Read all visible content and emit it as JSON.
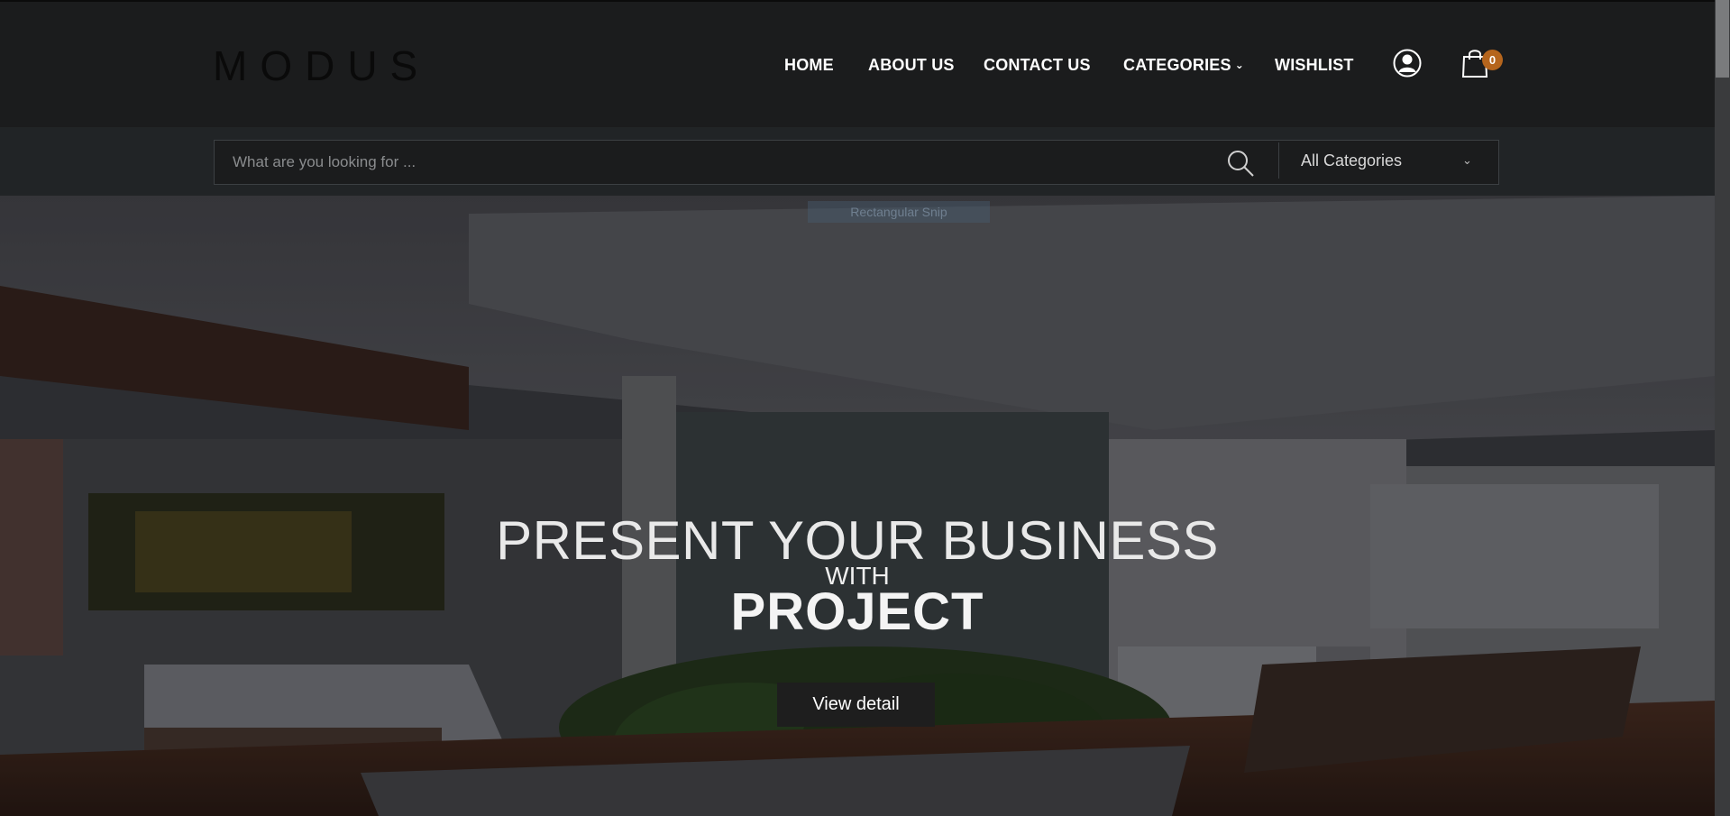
{
  "brand": {
    "logo_text": "MODUS"
  },
  "nav": {
    "items": [
      {
        "label": "HOME"
      },
      {
        "label": "ABOUT US"
      },
      {
        "label": "CONTACT US"
      },
      {
        "label": "CATEGORIES"
      },
      {
        "label": "WISHLIST"
      }
    ]
  },
  "cart": {
    "count": "0"
  },
  "search": {
    "placeholder": "What are you looking for ...",
    "category_selected": "All Categories"
  },
  "overlay": {
    "snip_label": "Rectangular Snip"
  },
  "hero": {
    "title_line1": "PRESENT YOUR BUSINESS",
    "title_line2": "WITH",
    "title_line3": "PROJECT",
    "button_label": "View detail"
  },
  "colors": {
    "header_bg": "#1b1c1d",
    "search_band_bg": "#212426",
    "badge": "#b5651d",
    "button_bg": "#1e1e1e"
  }
}
